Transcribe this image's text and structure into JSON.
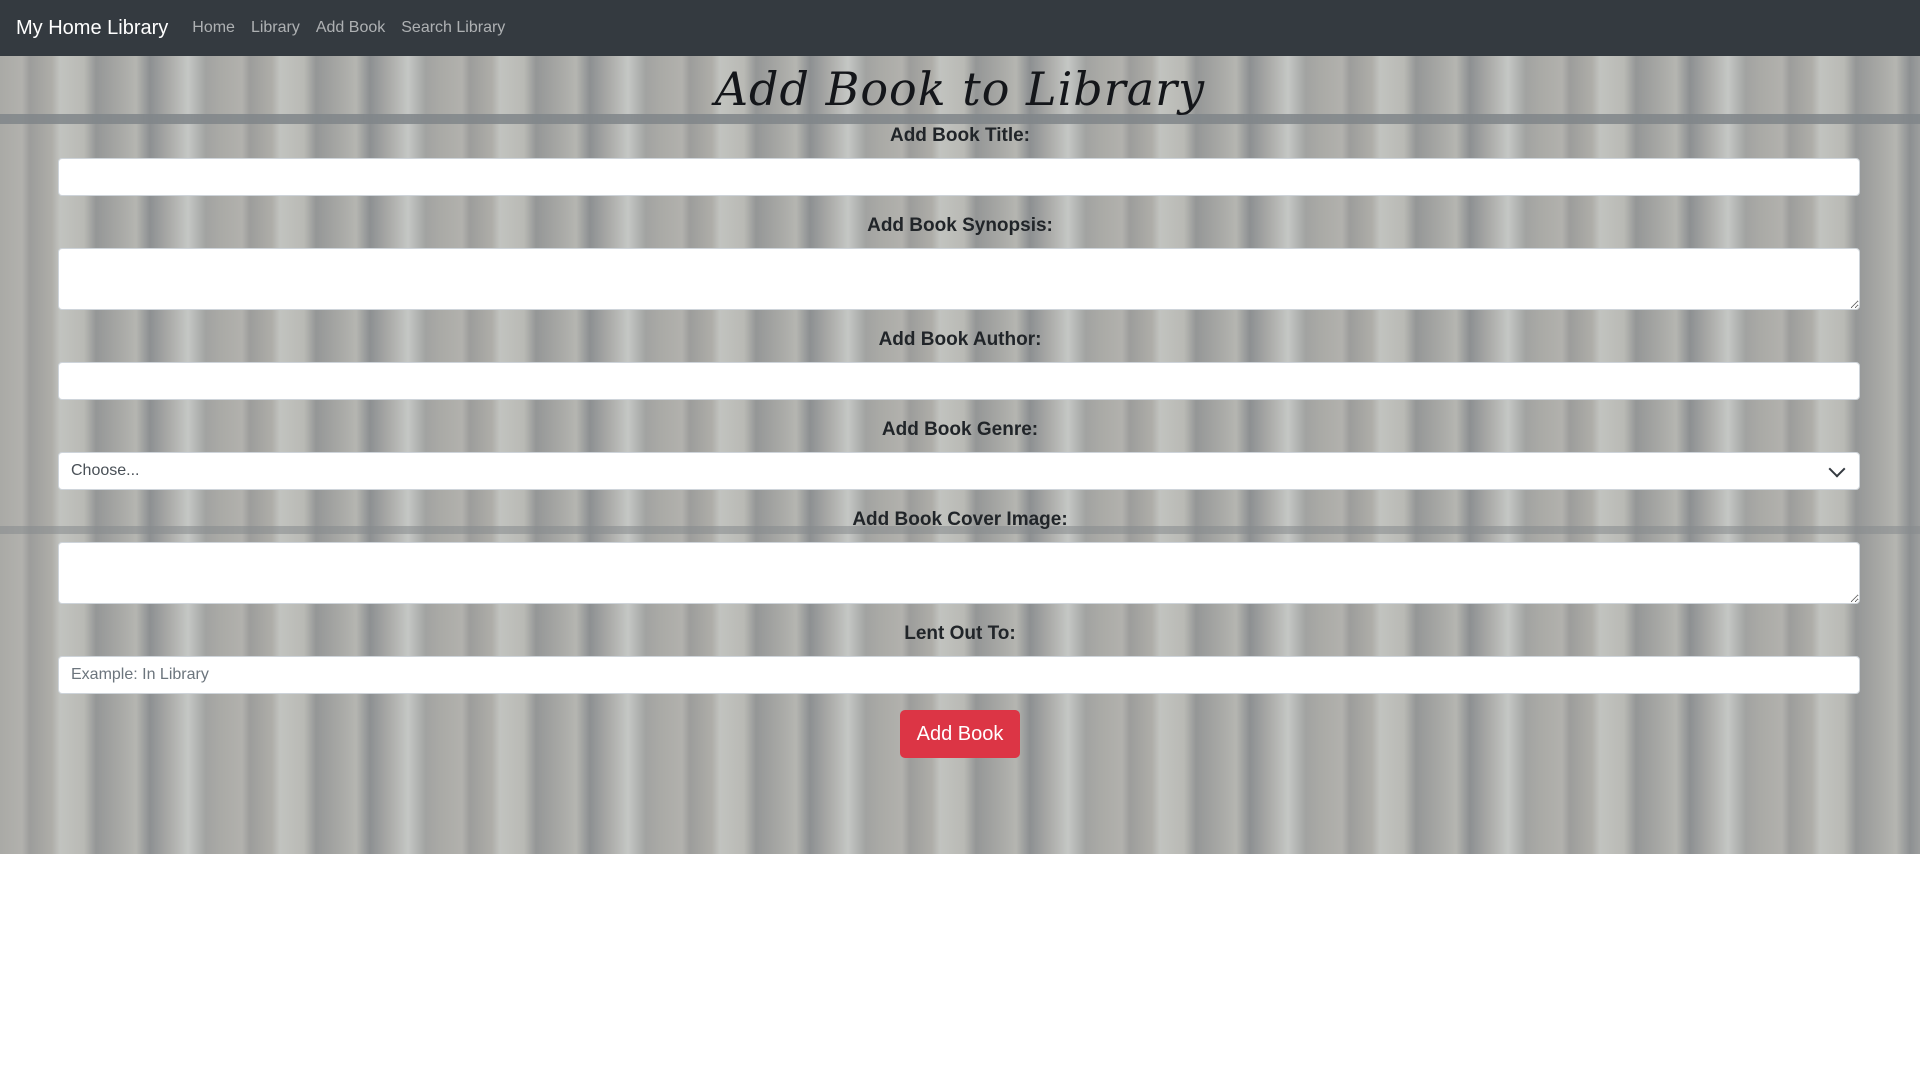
{
  "nav": {
    "brand": "My Home Library",
    "links": [
      "Home",
      "Library",
      "Add Book",
      "Search Library"
    ]
  },
  "page": {
    "title": "Add Book to Library"
  },
  "form": {
    "title_label": "Add Book Title:",
    "title_value": "",
    "synopsis_label": "Add Book Synopsis:",
    "synopsis_value": "",
    "author_label": "Add Book Author:",
    "author_value": "",
    "genre_label": "Add Book Genre:",
    "genre_selected": "Choose...",
    "cover_label": "Add Book Cover Image:",
    "cover_value": "",
    "lent_label": "Lent Out To:",
    "lent_placeholder": "Example: In Library",
    "submit_label": "Add Book"
  },
  "colors": {
    "navbar": "#343a40",
    "submit": "#dc3545"
  }
}
